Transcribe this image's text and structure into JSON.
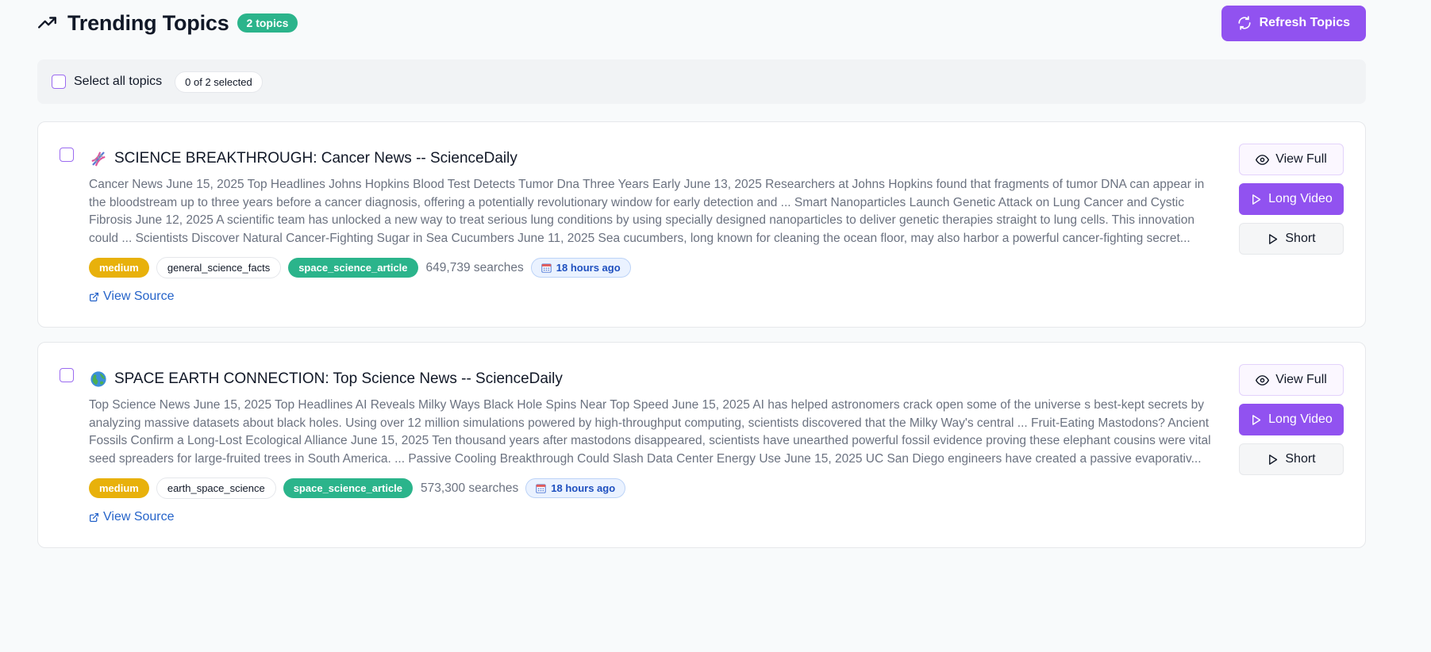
{
  "header": {
    "title": "Trending Topics",
    "count_badge": "2 topics",
    "refresh_label": "Refresh Topics"
  },
  "selection": {
    "select_all_label": "Select all topics",
    "selected_count": "0 of 2 selected"
  },
  "topics": [
    {
      "icon": "dna-icon",
      "title": "SCIENCE BREAKTHROUGH: Cancer News -- ScienceDaily",
      "description": "Cancer News June 15, 2025 Top Headlines Johns Hopkins Blood Test Detects Tumor Dna Three Years Early June 13, 2025 Researchers at Johns Hopkins found that fragments of tumor DNA can appear in the bloodstream up to three years before a cancer diagnosis, offering a potentially revolutionary window for early detection and ... Smart Nanoparticles Launch Genetic Attack on Lung Cancer and Cystic Fibrosis June 12, 2025 A scientific team has unlocked a new way to treat serious lung conditions by using specially designed nanoparticles to deliver genetic therapies straight to lung cells. This innovation could ... Scientists Discover Natural Cancer-Fighting Sugar in Sea Cucumbers June 11, 2025 Sea cucumbers, long known for cleaning the ocean floor, may also harbor a powerful cancer-fighting secret...",
      "priority": "medium",
      "category": "general_science_facts",
      "type": "space_science_article",
      "searches": "649,739 searches",
      "time": "18 hours ago",
      "source_label": "View Source"
    },
    {
      "icon": "globe-icon",
      "title": "SPACE EARTH CONNECTION: Top Science News -- ScienceDaily",
      "description": "Top Science News June 15, 2025 Top Headlines AI Reveals Milky Ways Black Hole Spins Near Top Speed June 15, 2025 AI has helped astronomers crack open some of the universe s best-kept secrets by analyzing massive datasets about black holes. Using over 12 million simulations powered by high-throughput computing, scientists discovered that the Milky Way's central ... Fruit-Eating Mastodons? Ancient Fossils Confirm a Long-Lost Ecological Alliance June 15, 2025 Ten thousand years after mastodons disappeared, scientists have unearthed powerful fossil evidence proving these elephant cousins were vital seed spreaders for large-fruited trees in South America. ... Passive Cooling Breakthrough Could Slash Data Center Energy Use June 15, 2025 UC San Diego engineers have created a passive evaporativ...",
      "priority": "medium",
      "category": "earth_space_science",
      "type": "space_science_article",
      "searches": "573,300 searches",
      "time": "18 hours ago",
      "source_label": "View Source"
    }
  ],
  "actions": {
    "view_full": "View Full",
    "long_video": "Long Video",
    "short": "Short"
  },
  "colors": {
    "accent_purple": "#9152f0",
    "green": "#2bb48b",
    "amber": "#e8b10b",
    "link_blue": "#2563c9"
  }
}
